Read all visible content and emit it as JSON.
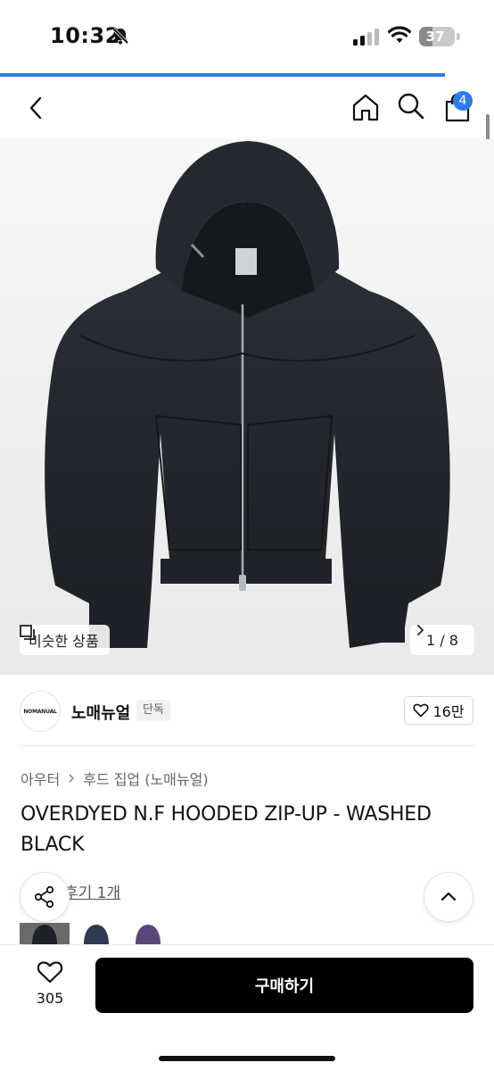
{
  "status_bar": {
    "time": "10:32",
    "battery": "37",
    "battery_level_percent": 37,
    "icons": [
      "bell-muted-icon",
      "signal-icon",
      "wifi-icon",
      "battery-icon"
    ]
  },
  "load_progress_percent": 90,
  "nav": {
    "icons": [
      "back-icon",
      "home-icon",
      "search-icon",
      "cart-icon"
    ],
    "cart_badge": "4",
    "accent_color": "#2d7be5"
  },
  "gallery": {
    "similar_label": "비슷한 상품",
    "counter": "1 / 8",
    "current": 1,
    "total": 8
  },
  "brand": {
    "logo_text": "NOMANUAL",
    "name": "노매뉴얼",
    "tag": "단독",
    "likes": "16만"
  },
  "breadcrumb": {
    "items": [
      "아우터",
      "후드 집업 (노매뉴얼)"
    ]
  },
  "product": {
    "title": "OVERDYED N.F HOODED ZIP-UP - WASHED BLACK",
    "review_link": "후기 1개"
  },
  "swatches": {
    "colors": [
      "#1e2228",
      "#2f3b52",
      "#5b4678"
    ]
  },
  "bottom_bar": {
    "wishlist_count": "305",
    "buy_label": "구매하기"
  }
}
